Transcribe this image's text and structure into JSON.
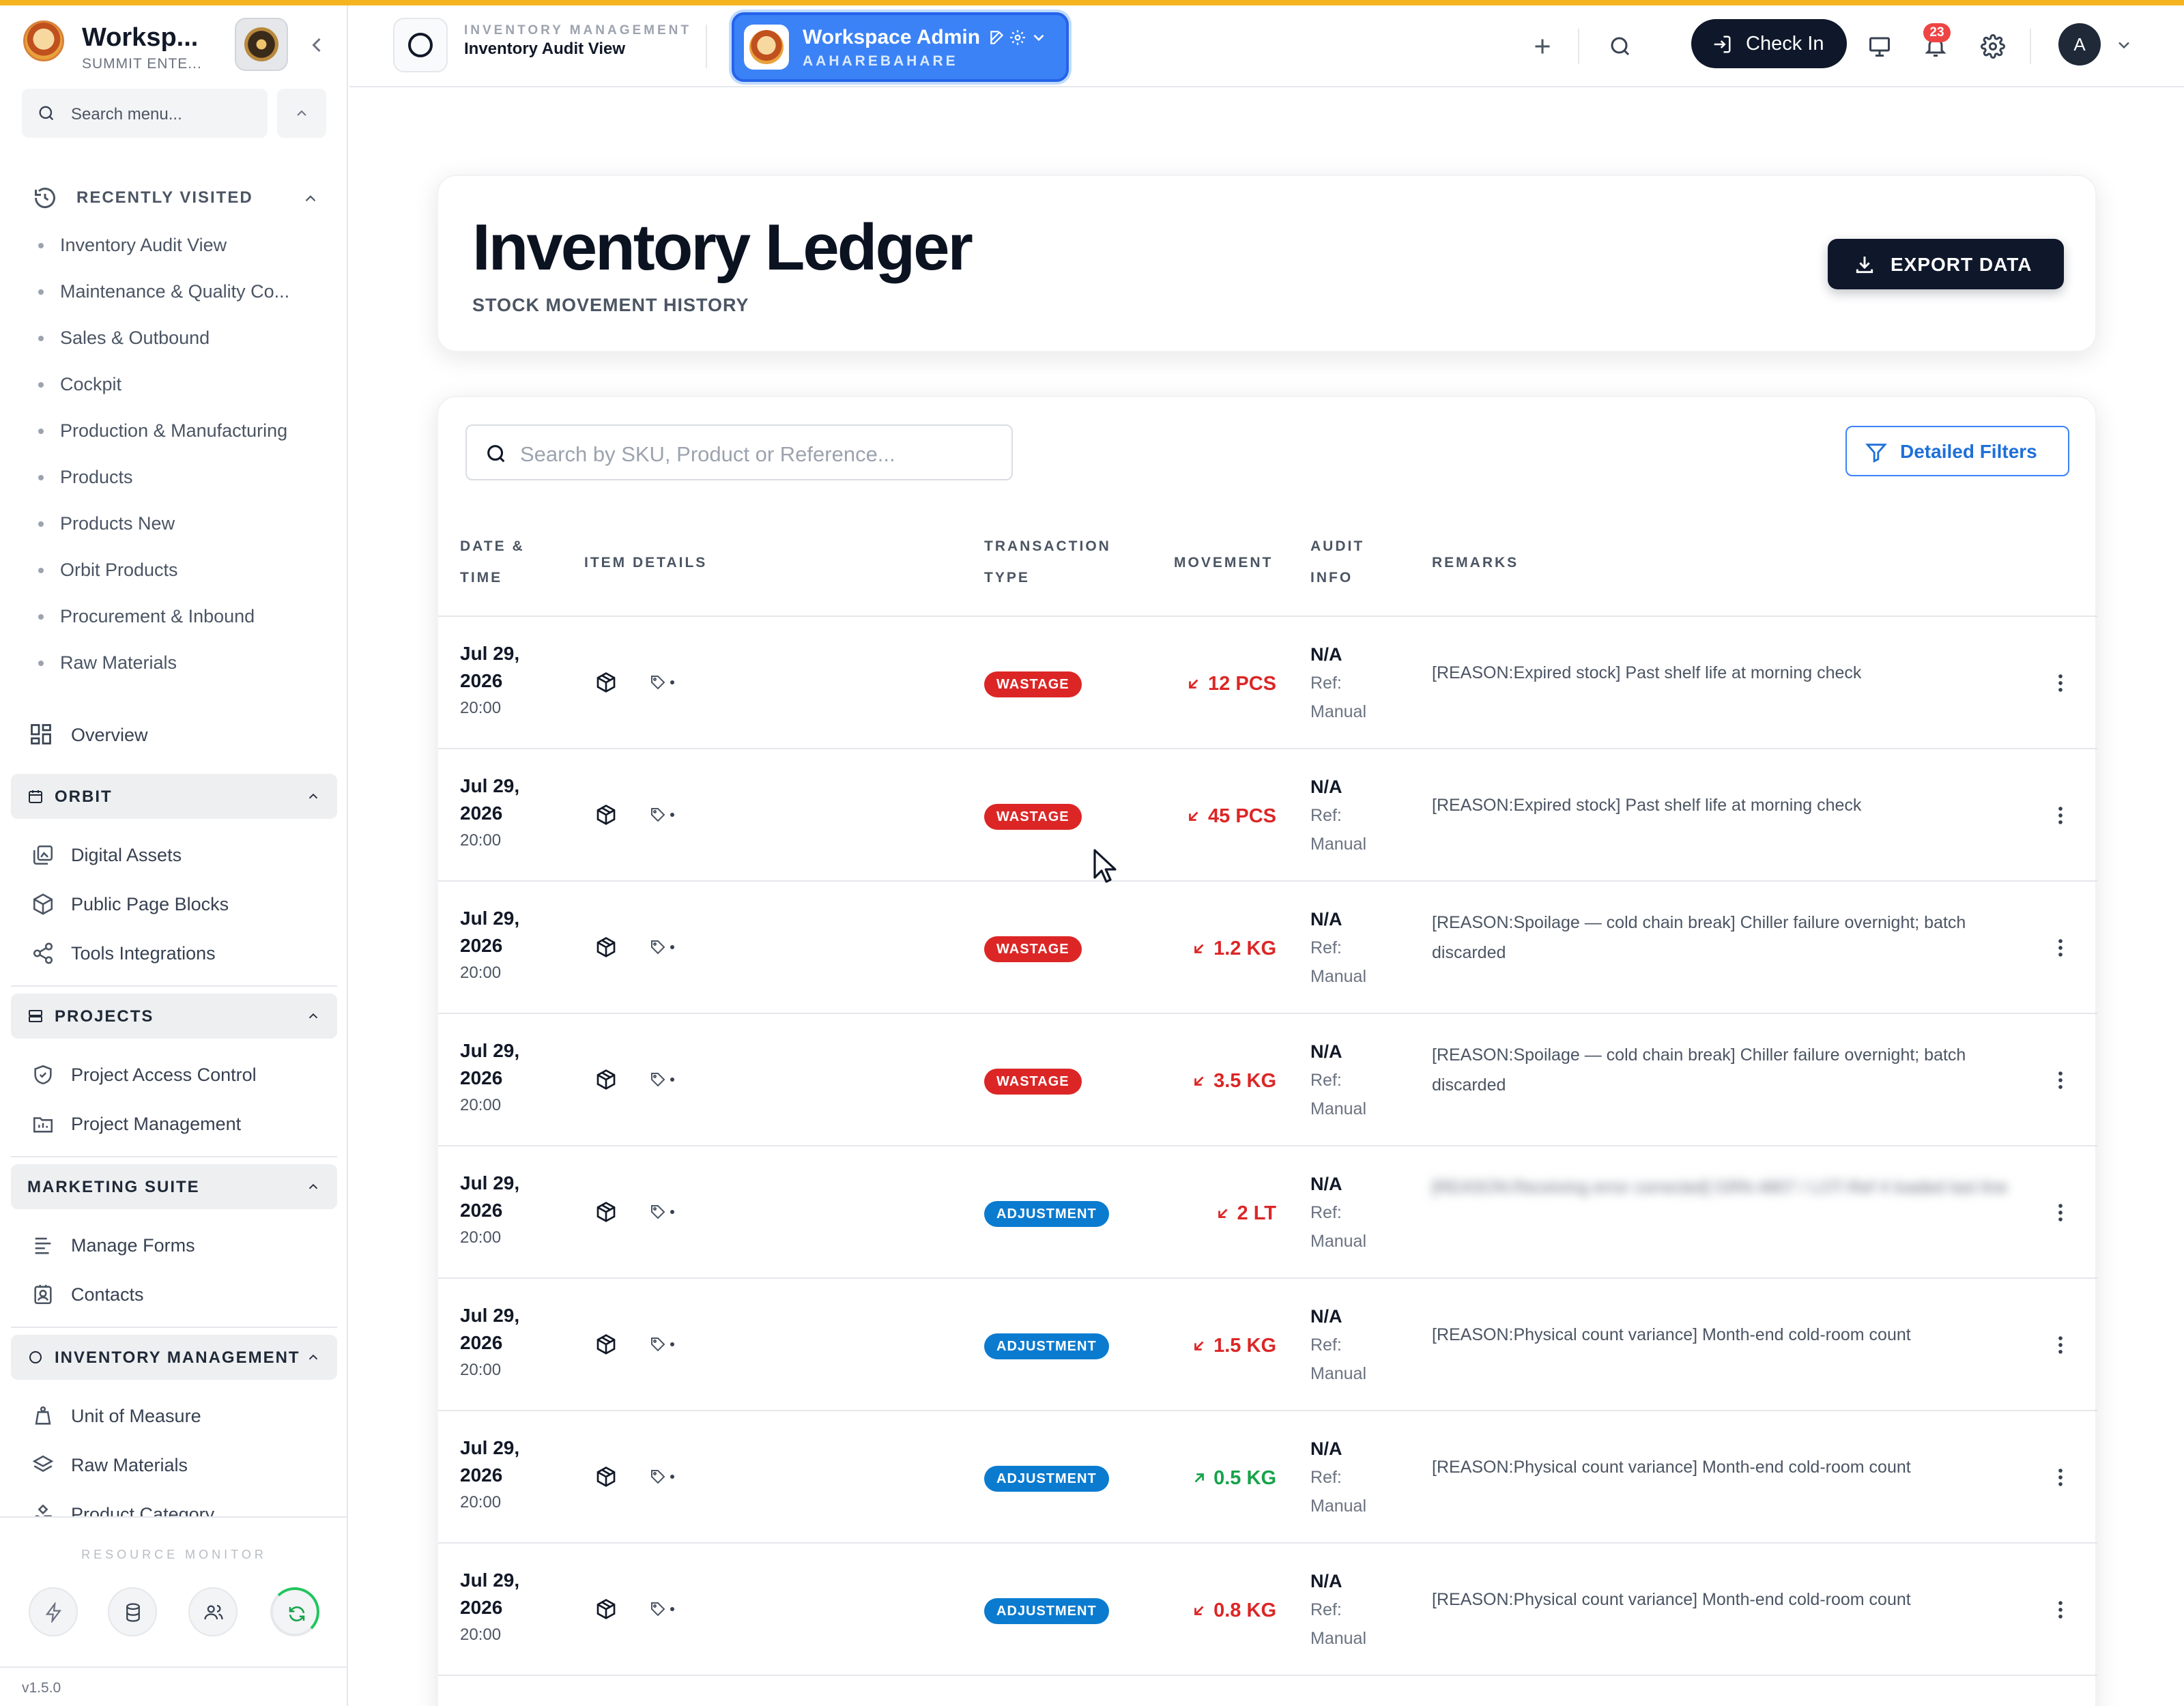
{
  "sidebar": {
    "workspace_name": "Worksp...",
    "workspace_sub": "SUMMIT ENTE...",
    "search_placeholder": "Search menu...",
    "recent_title": "RECENTLY VISITED",
    "recent_items": [
      "Inventory Audit View",
      "Maintenance & Quality Co...",
      "Sales & Outbound",
      "Cockpit",
      "Production & Manufacturing",
      "Products",
      "Products New",
      "Orbit Products",
      "Procurement & Inbound",
      "Raw Materials"
    ],
    "overview": "Overview",
    "groups": {
      "orbit": {
        "title": "ORBIT",
        "items": [
          "Digital Assets",
          "Public Page Blocks",
          "Tools Integrations"
        ]
      },
      "projects": {
        "title": "PROJECTS",
        "items": [
          "Project Access Control",
          "Project Management"
        ]
      },
      "marketing": {
        "title": "MARKETING SUITE",
        "items": [
          "Manage Forms",
          "Contacts"
        ]
      },
      "inventory": {
        "title": "INVENTORY MANAGEMENT",
        "items": [
          "Unit of Measure",
          "Raw Materials",
          "Product Category"
        ]
      }
    },
    "resource_monitor": "RESOURCE MONITOR",
    "version": "v1.5.0"
  },
  "topbar": {
    "module_label": "INVENTORY MANAGEMENT",
    "module_title": "Inventory Audit View",
    "workspace_name": "Workspace Admin",
    "workspace_sub": "AAHAREBAHARE",
    "checkin": "Check In",
    "notifications": "23",
    "user_initial": "A"
  },
  "hero": {
    "title": "Inventory Ledger",
    "subtitle": "STOCK MOVEMENT HISTORY",
    "export": "EXPORT DATA"
  },
  "table": {
    "search_placeholder": "Search by SKU, Product or Reference...",
    "filters": "Detailed Filters",
    "headers": {
      "date": [
        "DATE &",
        "TIME"
      ],
      "item": "ITEM DETAILS",
      "type": [
        "TRANSACTION",
        "TYPE"
      ],
      "movement": "MOVEMENT",
      "audit": [
        "AUDIT",
        "INFO"
      ],
      "remarks": "REMARKS"
    },
    "rows": [
      {
        "date1": "Jul 29,",
        "date2": "2026",
        "time": "20:00",
        "type": "WASTAGE",
        "kind": "w",
        "movement": "12 PCS",
        "dir": "neg",
        "audit1": "N/A",
        "audit2": "Ref:",
        "audit3": "Manual",
        "remarks": "[REASON:Expired stock] Past shelf life at morning check",
        "blur": false
      },
      {
        "date1": "Jul 29,",
        "date2": "2026",
        "time": "20:00",
        "type": "WASTAGE",
        "kind": "w",
        "movement": "45 PCS",
        "dir": "neg",
        "audit1": "N/A",
        "audit2": "Ref:",
        "audit3": "Manual",
        "remarks": "[REASON:Expired stock] Past shelf life at morning check",
        "blur": false
      },
      {
        "date1": "Jul 29,",
        "date2": "2026",
        "time": "20:00",
        "type": "WASTAGE",
        "kind": "w",
        "movement": "1.2 KG",
        "dir": "neg",
        "audit1": "N/A",
        "audit2": "Ref:",
        "audit3": "Manual",
        "remarks": "[REASON:Spoilage — cold chain break] Chiller failure overnight; batch discarded",
        "blur": false
      },
      {
        "date1": "Jul 29,",
        "date2": "2026",
        "time": "20:00",
        "type": "WASTAGE",
        "kind": "w",
        "movement": "3.5 KG",
        "dir": "neg",
        "audit1": "N/A",
        "audit2": "Ref:",
        "audit3": "Manual",
        "remarks": "[REASON:Spoilage — cold chain break] Chiller failure overnight; batch discarded",
        "blur": false
      },
      {
        "date1": "Jul 29,",
        "date2": "2026",
        "time": "20:00",
        "type": "ADJUSTMENT",
        "kind": "a",
        "movement": "2 LT",
        "dir": "neg",
        "audit1": "N/A",
        "audit2": "Ref:",
        "audit3": "Manual",
        "remarks": "[REASON:Receiving error corrected] GRN-4807 / LOT-Ref 4 loaded last line",
        "blur": true
      },
      {
        "date1": "Jul 29,",
        "date2": "2026",
        "time": "20:00",
        "type": "ADJUSTMENT",
        "kind": "a",
        "movement": "1.5 KG",
        "dir": "neg",
        "audit1": "N/A",
        "audit2": "Ref:",
        "audit3": "Manual",
        "remarks": "[REASON:Physical count variance] Month-end cold-room count",
        "blur": false
      },
      {
        "date1": "Jul 29,",
        "date2": "2026",
        "time": "20:00",
        "type": "ADJUSTMENT",
        "kind": "a",
        "movement": "0.5 KG",
        "dir": "pos",
        "audit1": "N/A",
        "audit2": "Ref:",
        "audit3": "Manual",
        "remarks": "[REASON:Physical count variance] Month-end cold-room count",
        "blur": false
      },
      {
        "date1": "Jul 29,",
        "date2": "2026",
        "time": "20:00",
        "type": "ADJUSTMENT",
        "kind": "a",
        "movement": "0.8 KG",
        "dir": "neg",
        "audit1": "N/A",
        "audit2": "Ref:",
        "audit3": "Manual",
        "remarks": "[REASON:Physical count variance] Month-end cold-room count",
        "blur": false
      }
    ]
  },
  "colors": {
    "accent": "#f5b41f",
    "brand": "#3b82f6",
    "wastage": "#dc2626",
    "adjustment": "#0b7bd0",
    "dark": "#0f172a"
  }
}
